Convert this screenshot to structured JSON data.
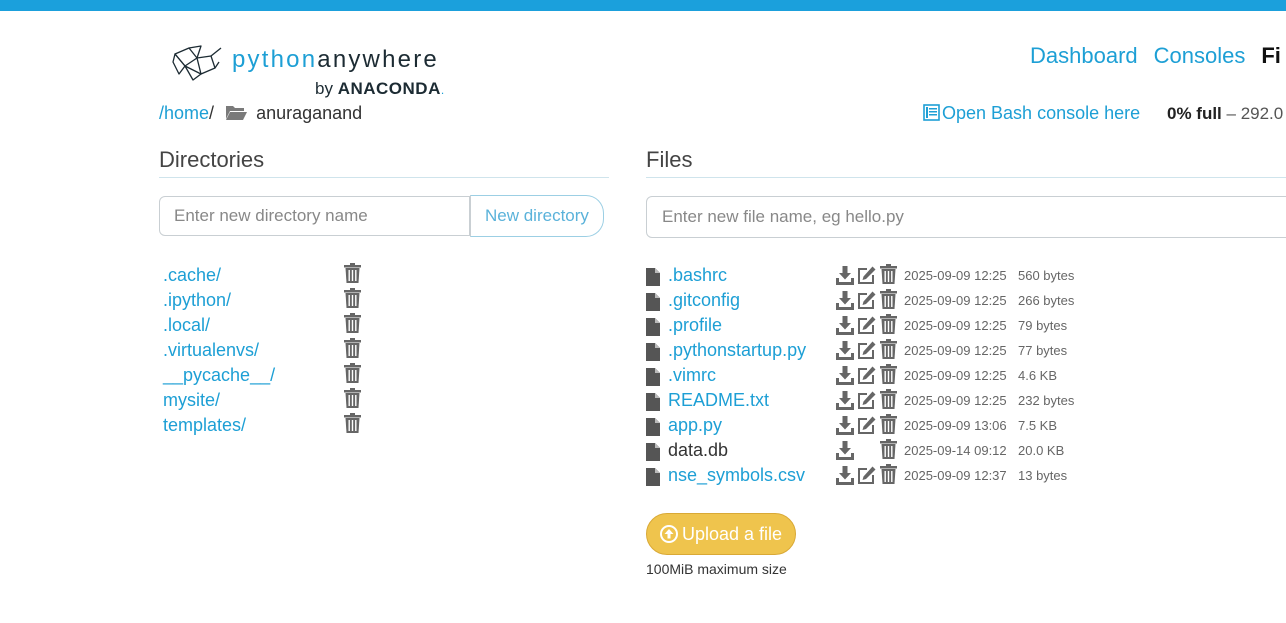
{
  "brand": {
    "name_light": "python",
    "name_bold": "anywhere",
    "by": "by",
    "company": "ANACONDA",
    "company_dot": "."
  },
  "nav": {
    "items": [
      "Dashboard",
      "Consoles",
      "Fi"
    ]
  },
  "breadcrumb": {
    "home": "/home",
    "sep": "/",
    "current": "anuraganand"
  },
  "bash_link": "Open Bash console here",
  "quota": {
    "percent": "0% full",
    "rest": " – 292.0"
  },
  "directories": {
    "title": "Directories",
    "input_placeholder": "Enter new directory name",
    "button": "New directory",
    "items": [
      ".cache/",
      ".ipython/",
      ".local/",
      ".virtualenvs/",
      "__pycache__/",
      "mysite/",
      "templates/"
    ]
  },
  "files": {
    "title": "Files",
    "input_placeholder": "Enter new file name, eg hello.py",
    "items": [
      {
        "name": ".bashrc",
        "date": "2025-09-09 12:25",
        "size": "560 bytes",
        "editable": true
      },
      {
        "name": ".gitconfig",
        "date": "2025-09-09 12:25",
        "size": "266 bytes",
        "editable": true
      },
      {
        "name": ".profile",
        "date": "2025-09-09 12:25",
        "size": "79 bytes",
        "editable": true
      },
      {
        "name": ".pythonstartup.py",
        "date": "2025-09-09 12:25",
        "size": "77 bytes",
        "editable": true
      },
      {
        "name": ".vimrc",
        "date": "2025-09-09 12:25",
        "size": "4.6 KB",
        "editable": true
      },
      {
        "name": "README.txt",
        "date": "2025-09-09 12:25",
        "size": "232 bytes",
        "editable": true
      },
      {
        "name": "app.py",
        "date": "2025-09-09 13:06",
        "size": "7.5 KB",
        "editable": true
      },
      {
        "name": "data.db",
        "date": "2025-09-14 09:12",
        "size": "20.0 KB",
        "editable": false
      },
      {
        "name": "nse_symbols.csv",
        "date": "2025-09-09 12:37",
        "size": "13 bytes",
        "editable": true
      }
    ],
    "upload_button": "Upload a file",
    "upload_note": "100MiB maximum size"
  },
  "colors": {
    "accent": "#1d9fd5",
    "topbar": "#1ba0dc",
    "upload": "#efc44d"
  }
}
